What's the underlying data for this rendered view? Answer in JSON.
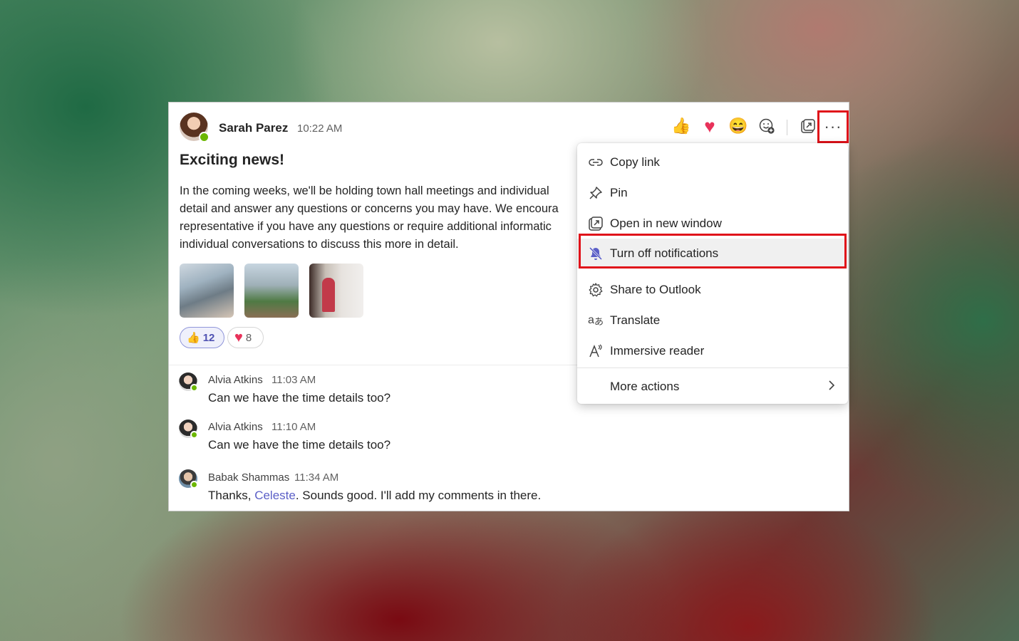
{
  "message": {
    "author": "Sarah Parez",
    "time": "10:22 AM",
    "title": "Exciting news!",
    "body_lines": [
      "In the coming weeks, we'll be holding town hall meetings and individual",
      "detail and answer any questions or concerns you may have. We encoura",
      "representative if you have any questions or require additional informatic",
      "individual conversations to discuss this more in detail."
    ],
    "reactions": [
      {
        "icon": "thumbs-up-icon",
        "glyph": "👍",
        "count": "12"
      },
      {
        "icon": "heart-icon",
        "glyph": "♥",
        "count": "8"
      }
    ]
  },
  "toolbar": {
    "like_glyph": "👍",
    "heart_glyph": "♥",
    "laugh_glyph": "😄",
    "more_glyph": "···"
  },
  "replies": [
    {
      "name": "Alvia Atkins",
      "time": "11:03 AM",
      "text": "Can we have the time details too?"
    },
    {
      "name": "Alvia Atkins",
      "time": "11:10 AM",
      "text": "Can we have the time details too?"
    },
    {
      "name": "Babak Shammas",
      "time": "11:34 AM",
      "text_before": "Thanks, ",
      "mention": "Celeste",
      "text_after": ". Sounds good. I'll add my comments in there."
    }
  ],
  "menu": {
    "items": [
      {
        "label": "Copy link",
        "icon": "link-icon"
      },
      {
        "label": "Pin",
        "icon": "pin-icon"
      },
      {
        "label": "Open in new window",
        "icon": "pop-out-icon"
      },
      {
        "label": "Turn off notifications",
        "icon": "bell-off-icon"
      },
      {
        "label": "Share to Outlook",
        "icon": "gear-icon"
      },
      {
        "label": "Translate",
        "icon": "translate-icon"
      },
      {
        "label": "Immersive reader",
        "icon": "immersive-reader-icon"
      },
      {
        "label": "More actions",
        "icon": "chevron-right-icon"
      }
    ]
  },
  "colors": {
    "highlight_outline": "#e0121a",
    "accent": "#5b5fc7",
    "presence": "#6bb700"
  }
}
